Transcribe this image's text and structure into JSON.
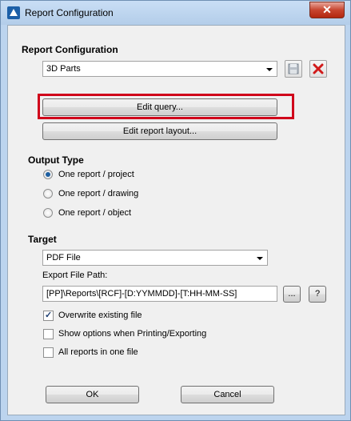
{
  "window": {
    "title": "Report Configuration",
    "close_glyph": "✕"
  },
  "report_configuration": {
    "heading": "Report Configuration",
    "selected": "3D Parts",
    "edit_query_label": "Edit query...",
    "edit_layout_label": "Edit report layout..."
  },
  "output_type": {
    "heading": "Output Type",
    "options": [
      "One report / project",
      "One report / drawing",
      "One report / object"
    ],
    "selected_index": 0
  },
  "target": {
    "heading": "Target",
    "selected": "PDF File",
    "export_path_label": "Export File Path:",
    "export_path_value": "[PP]\\Reports\\[RCF]-[D:YYMMDD]-[T:HH-MM-SS]",
    "browse_label": "...",
    "help_label": "?"
  },
  "checkboxes": [
    {
      "label": "Overwrite existing file",
      "checked": true
    },
    {
      "label": "Show options when Printing/Exporting",
      "checked": false
    },
    {
      "label": "All reports in one file",
      "checked": false
    }
  ],
  "footer": {
    "ok_label": "OK",
    "cancel_label": "Cancel"
  },
  "icons": [
    "autodesk-logo-icon",
    "save-icon",
    "delete-icon"
  ],
  "colors": {
    "highlight": "#d0021b",
    "close_button": "#c7452f",
    "radio_dot": "#1d5fa1"
  }
}
